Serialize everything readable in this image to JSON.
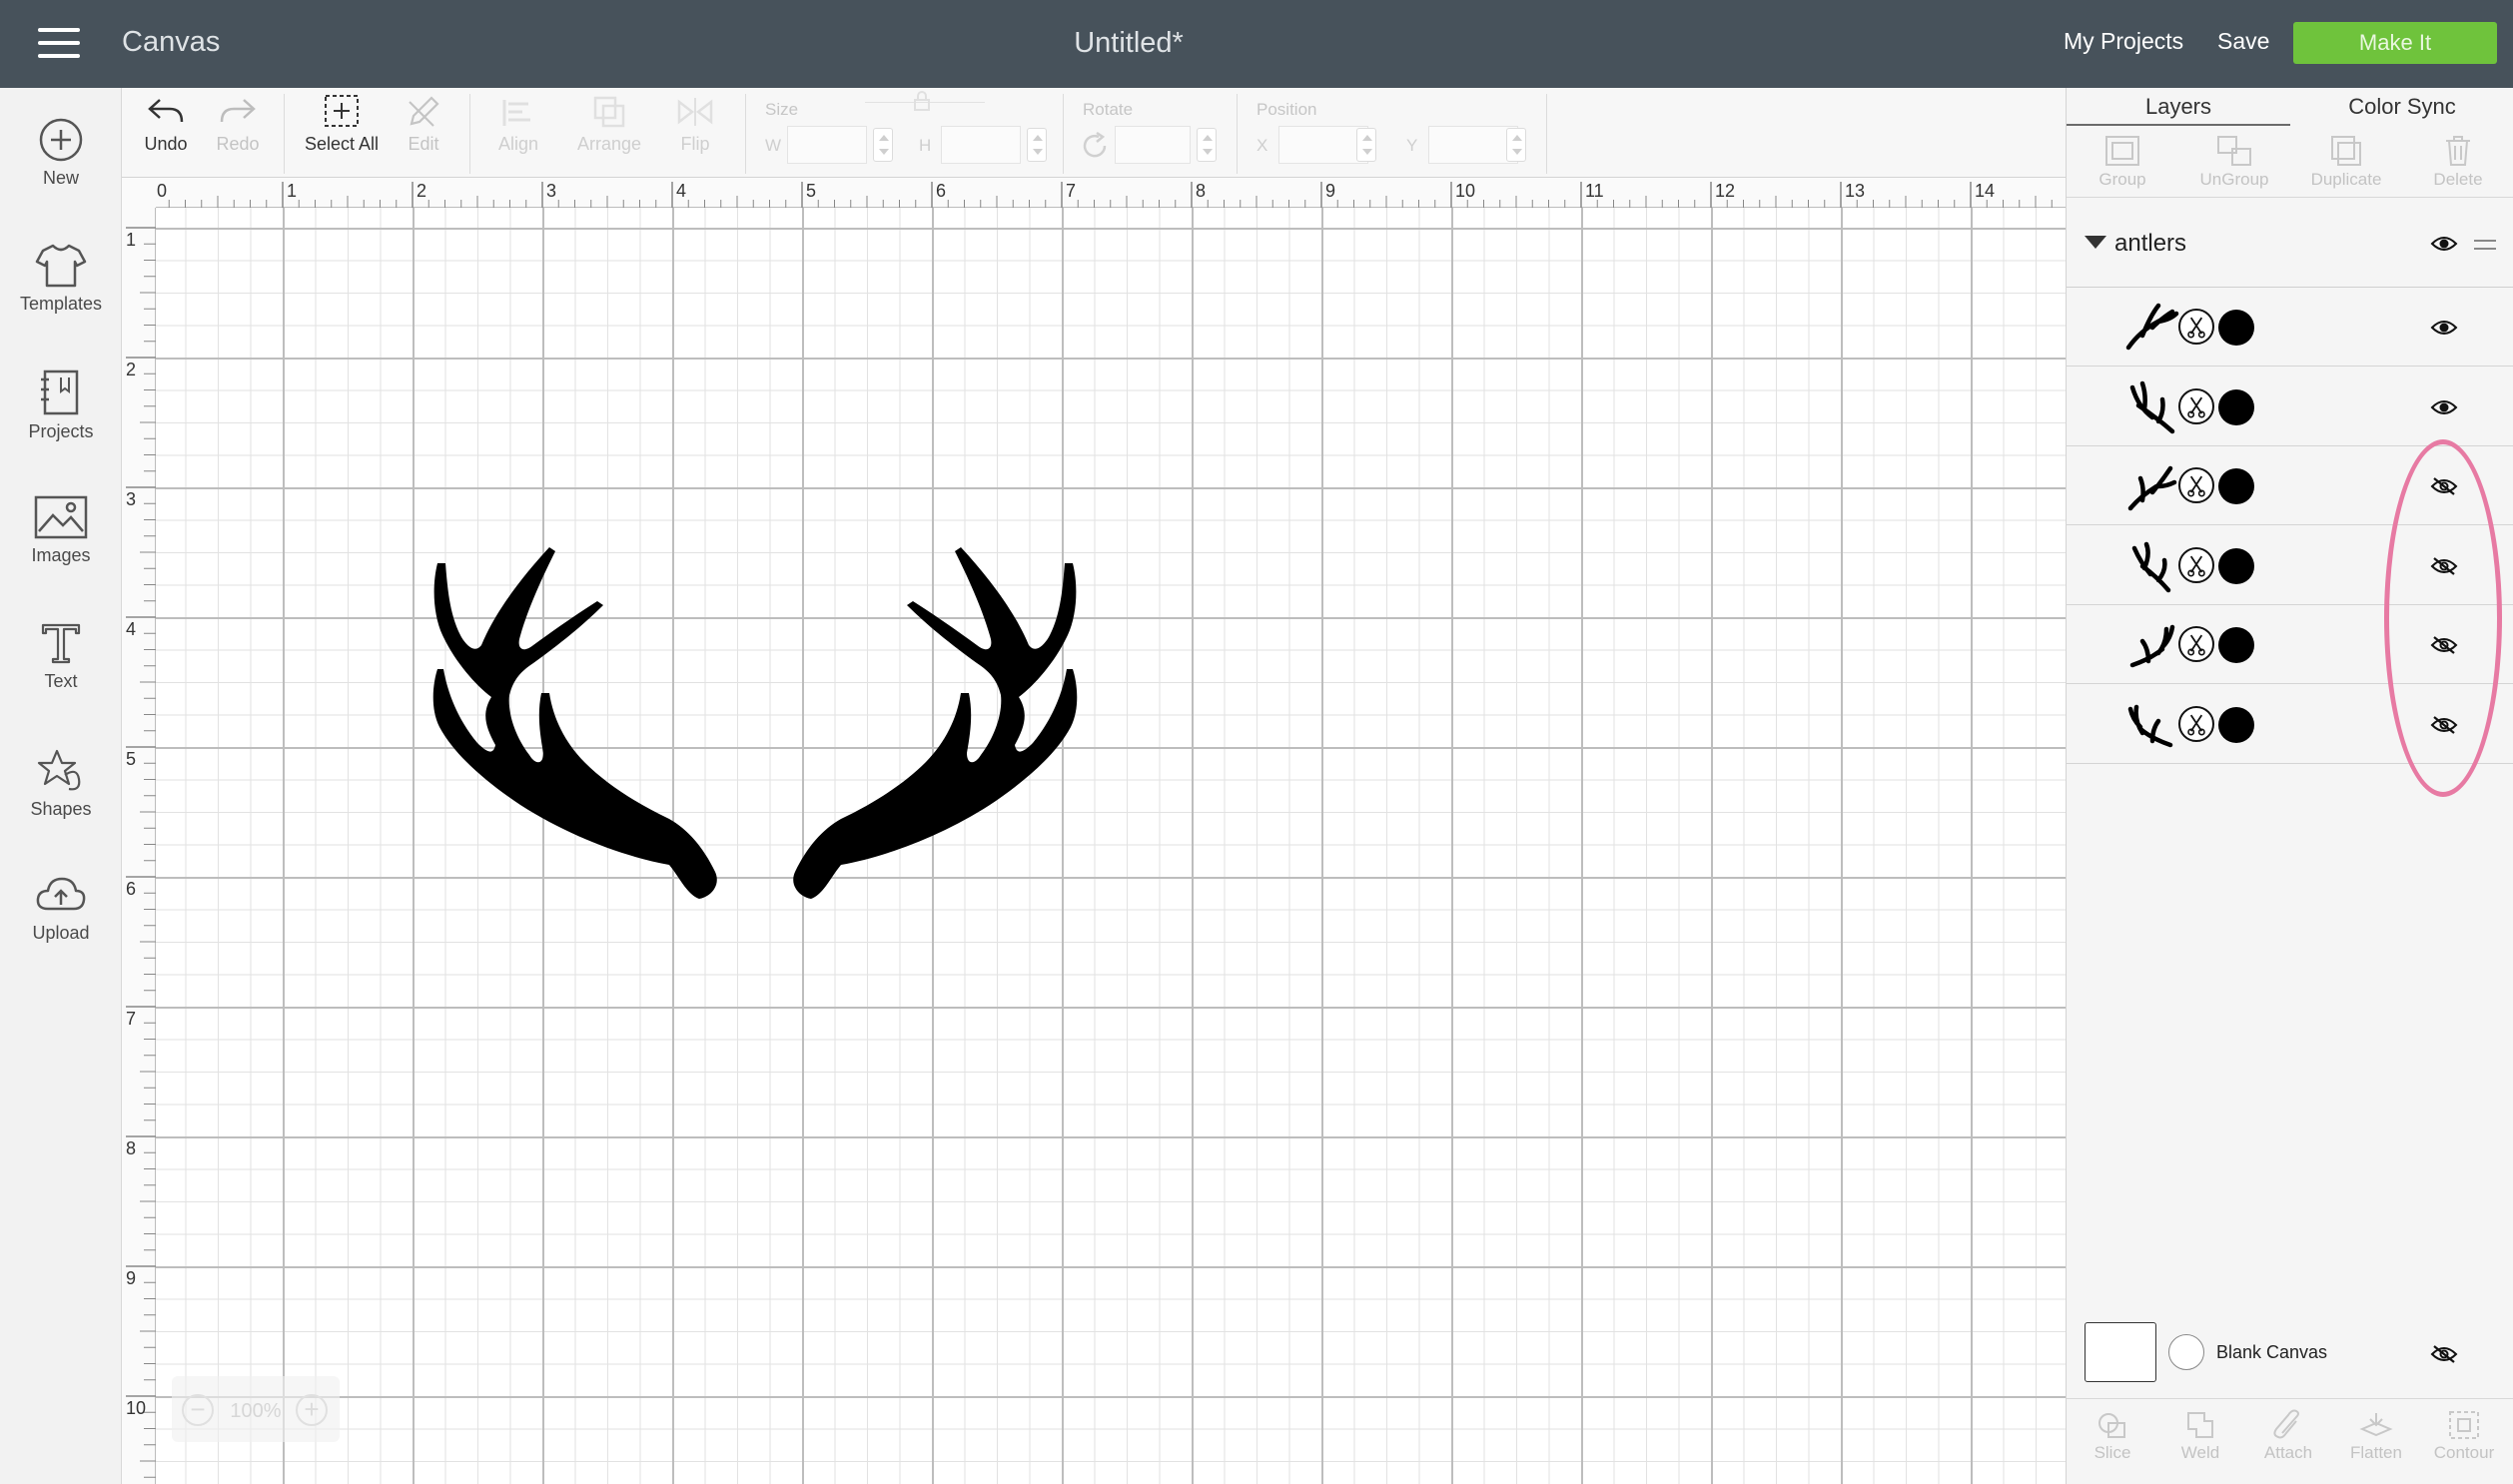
{
  "header": {
    "app_name": "Canvas",
    "doc_title": "Untitled*",
    "my_projects": "My Projects",
    "save": "Save",
    "make_it": "Make It"
  },
  "sidebar": {
    "items": [
      {
        "label": "New",
        "icon": "plus-circle-icon"
      },
      {
        "label": "Templates",
        "icon": "tshirt-icon"
      },
      {
        "label": "Projects",
        "icon": "notebook-icon"
      },
      {
        "label": "Images",
        "icon": "image-icon"
      },
      {
        "label": "Text",
        "icon": "text-icon"
      },
      {
        "label": "Shapes",
        "icon": "shapes-icon"
      },
      {
        "label": "Upload",
        "icon": "cloud-upload-icon"
      }
    ]
  },
  "toolbar": {
    "undo": "Undo",
    "redo": "Redo",
    "select_all": "Select All",
    "edit": "Edit",
    "align": "Align",
    "arrange": "Arrange",
    "flip": "Flip",
    "size_title": "Size",
    "width_letter": "W",
    "height_letter": "H",
    "rotate_title": "Rotate",
    "position_title": "Position",
    "x_letter": "X",
    "y_letter": "Y"
  },
  "rulers": {
    "horizontal": [
      "0",
      "1",
      "2",
      "3",
      "4",
      "5",
      "6",
      "7",
      "8",
      "9",
      "10",
      "11",
      "12",
      "13",
      "14"
    ],
    "vertical": [
      "1",
      "2",
      "3",
      "4",
      "5",
      "6",
      "7",
      "8",
      "9",
      "10"
    ]
  },
  "zoom": {
    "value": "100%",
    "minus": "−",
    "plus": "+"
  },
  "panel": {
    "tabs": [
      "Layers",
      "Color Sync"
    ],
    "tools": [
      "Group",
      "UnGroup",
      "Duplicate",
      "Delete"
    ],
    "group_name": "antlers",
    "layers": [
      {
        "visible": true,
        "color": "#000000"
      },
      {
        "visible": true,
        "color": "#000000"
      },
      {
        "visible": false,
        "color": "#000000"
      },
      {
        "visible": false,
        "color": "#000000"
      },
      {
        "visible": false,
        "color": "#000000"
      },
      {
        "visible": false,
        "color": "#000000"
      }
    ],
    "blank_canvas": "Blank Canvas",
    "bottom_tools": [
      "Slice",
      "Weld",
      "Attach",
      "Flatten",
      "Contour"
    ]
  },
  "colors": {
    "topbar": "#47525b",
    "make_it": "#6fc33c",
    "highlight": "#e77aa3"
  }
}
